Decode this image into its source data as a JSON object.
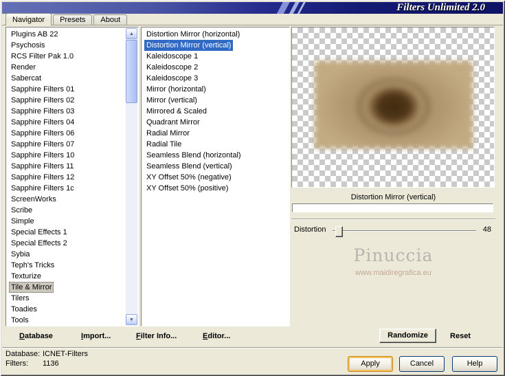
{
  "window_title": "Filters Unlimited 2.0",
  "tabs": [
    "Navigator",
    "Presets",
    "About"
  ],
  "categories": {
    "items": [
      "Plugins AB 22",
      "Psychosis",
      "RCS Filter Pak 1.0",
      "Render",
      "Sabercat",
      "Sapphire Filters 01",
      "Sapphire Filters 02",
      "Sapphire Filters 03",
      "Sapphire Filters 04",
      "Sapphire Filters 06",
      "Sapphire Filters 07",
      "Sapphire Filters 10",
      "Sapphire Filters 11",
      "Sapphire Filters 12",
      "Sapphire Filters 1c",
      "ScreenWorks",
      "Scribe",
      "Simple",
      "Special Effects 1",
      "Special Effects 2",
      "Sybia",
      "Teph's Tricks",
      "Texturize",
      "Tile & Mirror",
      "Tilers",
      "Toadies",
      "Tools"
    ],
    "selected_index": 23
  },
  "filters_list": {
    "items": [
      "Distortion Mirror (horizontal)",
      "Distortion Mirror (vertical)",
      "Kaleidoscope 1",
      "Kaleidoscope 2",
      "Kaleidoscope 3",
      "Mirror (horizontal)",
      "Mirror (vertical)",
      "Mirrored & Scaled",
      "Quadrant Mirror",
      "Radial Mirror",
      "Radial Tile",
      "Seamless Blend (horizontal)",
      "Seamless Blend (vertical)",
      "XY Offset 50% (negative)",
      "XY Offset 50% (positive)"
    ],
    "selected_index": 1
  },
  "preview": {
    "caption": "Distortion Mirror (vertical)"
  },
  "slider": {
    "label": "Distortion",
    "value": "48"
  },
  "watermark": {
    "name": "Pinuccia",
    "url": "www.maidiregrafica.eu"
  },
  "commands": {
    "database": "Database",
    "import": "Import...",
    "filter_info": "Filter Info...",
    "editor": "Editor...",
    "randomize": "Randomize",
    "reset": "Reset"
  },
  "status": {
    "database_label": "Database:",
    "database_value": "ICNET-Filters",
    "filters_label": "Filters:",
    "filters_value": "1136"
  },
  "action_buttons": {
    "apply": "Apply",
    "cancel": "Cancel",
    "help": "Help"
  },
  "scrollbar": {
    "up": "▲",
    "down": "▼"
  },
  "colors": {
    "selection_blue": "#316ac5",
    "titlebar_navy": "#131a72",
    "apply_highlight": "#f9c05a",
    "dialog_gray": "#ece9d8"
  }
}
